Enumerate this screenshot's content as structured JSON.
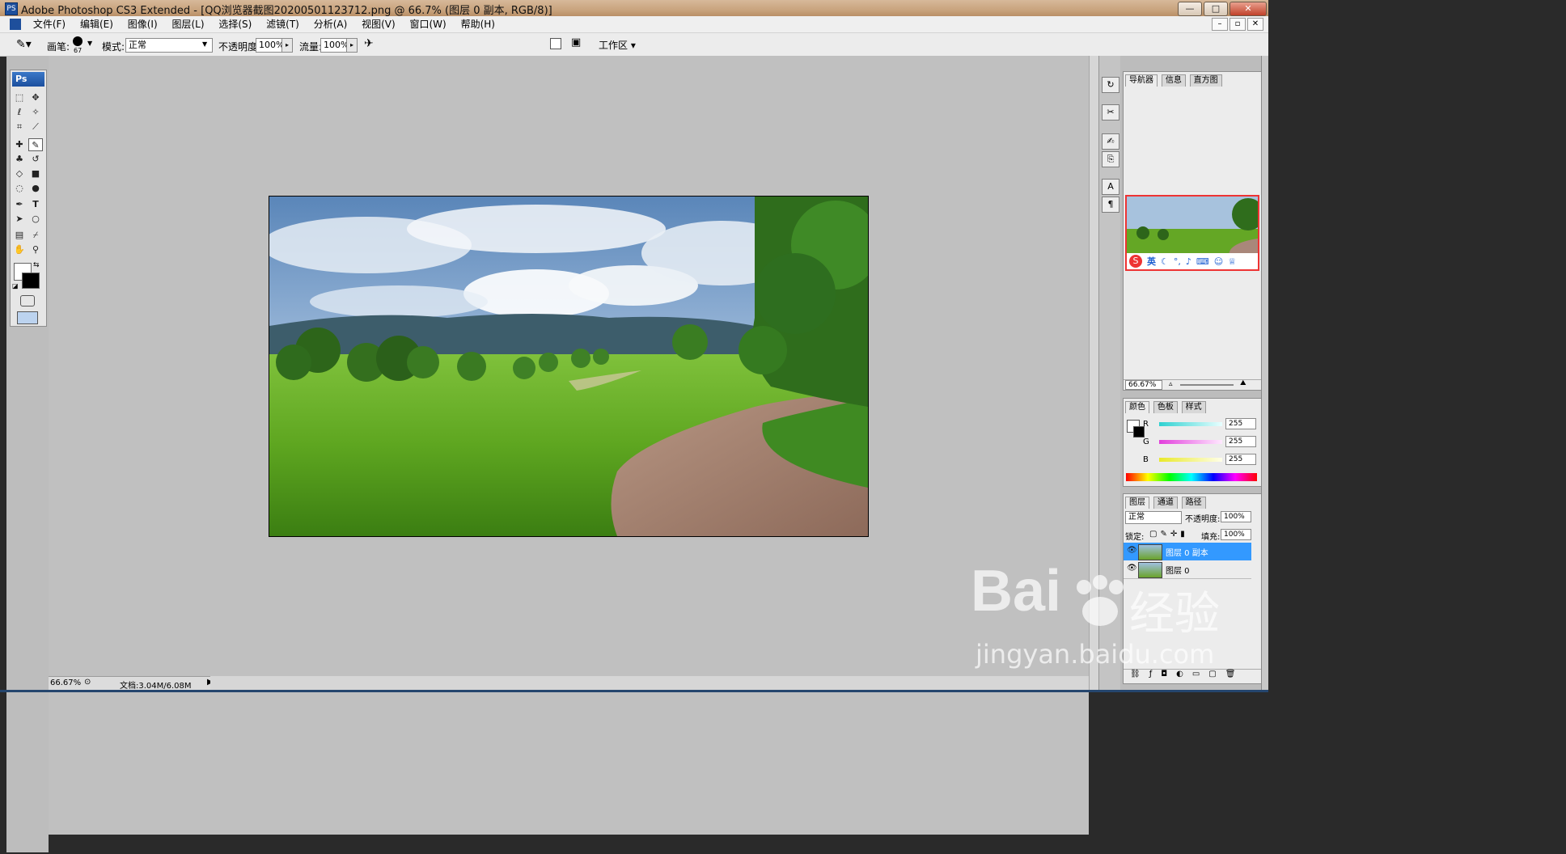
{
  "titlebar": {
    "app_icon": "PS",
    "title": "Adobe Photoshop CS3 Extended - [QQ浏览器截图20200501123712.png @ 66.7% (图层 0 副本, RGB/8)]",
    "minimize": "—",
    "restore": "□",
    "close": "✕"
  },
  "menu": [
    "文件(F)",
    "编辑(E)",
    "图像(I)",
    "图层(L)",
    "选择(S)",
    "滤镜(T)",
    "分析(A)",
    "视图(V)",
    "窗口(W)",
    "帮助(H)"
  ],
  "options": {
    "brush_label": "画笔:",
    "brush_size": "67",
    "mode_label": "模式:",
    "mode_value": "正常",
    "opacity_label": "不透明度:",
    "opacity_value": "100%",
    "flow_label": "流量:",
    "flow_value": "100%",
    "workspace_label": "工作区 ▾"
  },
  "toolbox": {
    "header": "Ps"
  },
  "status": {
    "zoom": "66.67%",
    "doc_info": "文档:3.04M/6.08M"
  },
  "navigator": {
    "tabs": [
      "导航器",
      "信息",
      "直方图"
    ],
    "zoom": "66.67%",
    "ime_label": "英"
  },
  "color_panel": {
    "tabs": [
      "颜色",
      "色板",
      "样式"
    ],
    "channels": [
      {
        "label": "R",
        "value": "255",
        "color": "#2ed1d1"
      },
      {
        "label": "G",
        "value": "255",
        "color": "#e23fdc"
      },
      {
        "label": "B",
        "value": "255",
        "color": "#e9e92a"
      }
    ]
  },
  "layers_panel": {
    "tabs": [
      "图层",
      "通道",
      "路径"
    ],
    "blend_mode": "正常",
    "opacity_label": "不透明度:",
    "opacity_value": "100%",
    "lock_label": "锁定:",
    "fill_label": "填充:",
    "fill_value": "100%",
    "layers": [
      {
        "name": "图层 0 副本",
        "selected": true
      },
      {
        "name": "图层 0",
        "selected": false
      }
    ]
  },
  "watermark": {
    "brand": "Bai",
    "brand2": "经验",
    "url": "jingyan.baidu.com"
  },
  "colors": {
    "accent": "#3399ff",
    "canvas_bg": "#c0c0c0"
  }
}
